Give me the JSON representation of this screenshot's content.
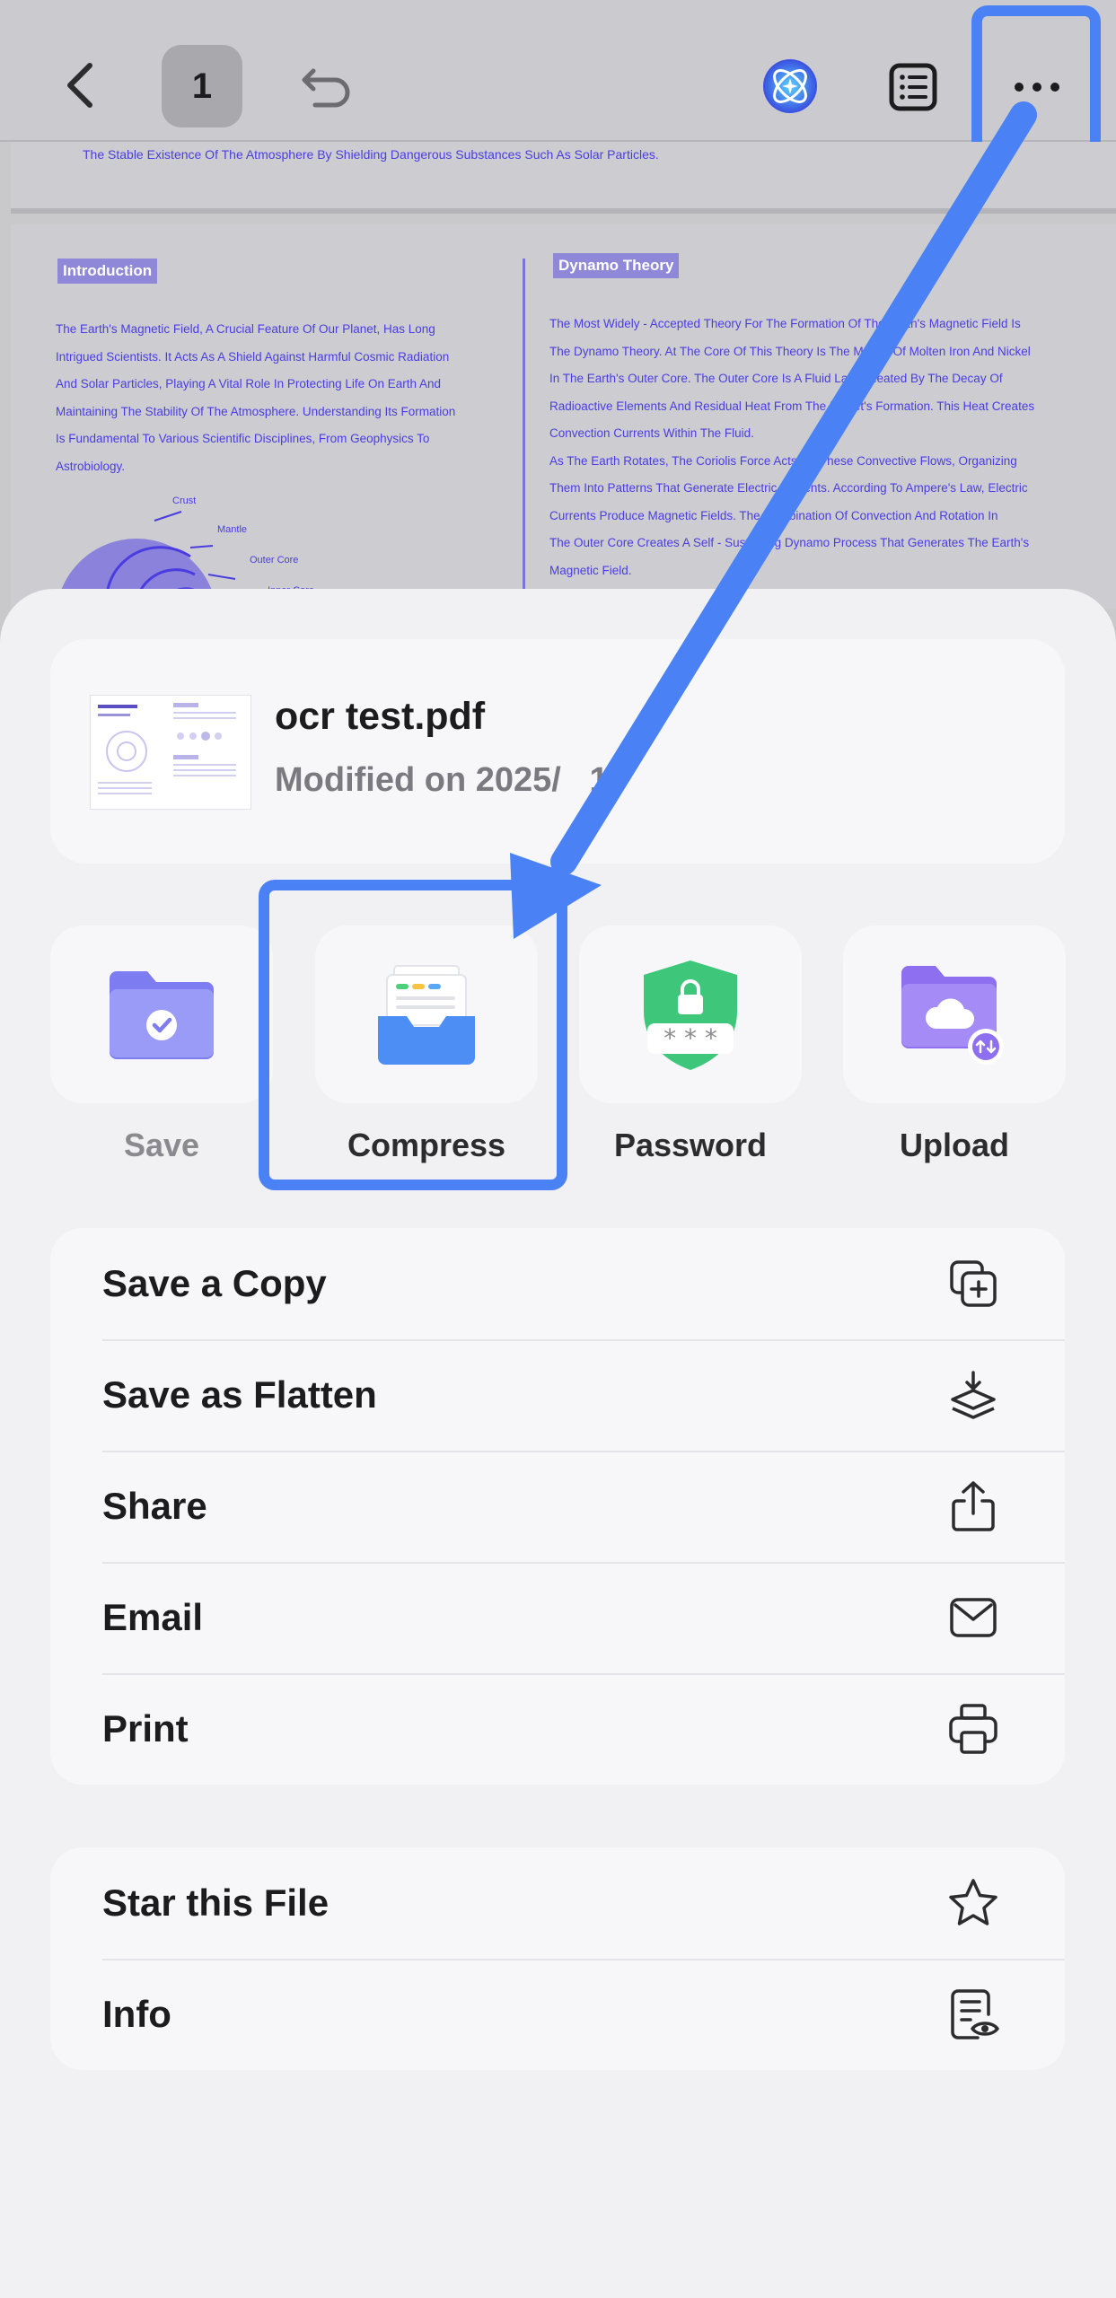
{
  "toolbar": {
    "page_number": "1",
    "icons": [
      "back-icon",
      "undo-icon",
      "ai-assistant-icon",
      "outline-icon",
      "more-icon"
    ]
  },
  "document": {
    "top_line": "The Stable Existence Of The Atmosphere By Shielding Dangerous Substances Such As Solar Particles.",
    "intro_heading": "Introduction",
    "intro_text": "The Earth's Magnetic Field, A Crucial Feature Of Our Planet, Has Long\nIntrigued Scientists. It Acts As A Shield Against Harmful Cosmic Radiation\nAnd Solar Particles, Playing A Vital Role In Protecting Life On Earth And\nMaintaining The Stability Of The Atmosphere. Understanding Its Formation\nIs Fundamental To Various Scientific Disciplines, From Geophysics To\nAstrobiology.",
    "diagram_labels": [
      "Crust",
      "Mantle",
      "Outer Core",
      "Inner Core"
    ],
    "dynamo_heading": "Dynamo Theory",
    "dynamo_text": "The Most Widely - Accepted Theory For The Formation Of The Earth's Magnetic Field Is\nThe Dynamo Theory. At The Core Of This Theory Is The Motion Of Molten Iron And Nickel\nIn The Earth's Outer Core. The Outer Core Is A Fluid Layer Heated By The Decay Of\nRadioactive Elements And Residual Heat From The Planet's Formation. This Heat Creates\nConvection Currents Within The Fluid.\nAs The Earth Rotates, The Coriolis Force Acts On These Convective Flows, Organizing\nThem Into Patterns That Generate Electric Currents. According To Ampere's Law, Electric\nCurrents Produce Magnetic Fields. The Combination Of Convection And Rotation In\nThe Outer Core Creates A Self - Sustaining Dynamo Process That Generates The Earth's\nMagnetic Field."
  },
  "file": {
    "name": "ocr test.pdf",
    "modified": "Modified on 2025/   10"
  },
  "actions": [
    {
      "label": "Save",
      "icon": "save-folder-icon",
      "enabled": false
    },
    {
      "label": "Compress",
      "icon": "compress-icon",
      "enabled": true
    },
    {
      "label": "Password",
      "icon": "password-shield-icon",
      "enabled": true
    },
    {
      "label": "Upload",
      "icon": "cloud-upload-folder-icon",
      "enabled": true
    }
  ],
  "menu_group_1": [
    {
      "label": "Save a Copy",
      "icon": "copy-plus-icon"
    },
    {
      "label": "Save as Flatten",
      "icon": "flatten-layers-icon"
    },
    {
      "label": "Share",
      "icon": "share-icon"
    },
    {
      "label": "Email",
      "icon": "mail-icon"
    },
    {
      "label": "Print",
      "icon": "printer-icon"
    }
  ],
  "menu_group_2": [
    {
      "label": "Star this File",
      "icon": "star-icon"
    },
    {
      "label": "Info",
      "icon": "info-document-icon"
    }
  ],
  "colors": {
    "highlight": "#4a82f5",
    "doc_text": "#4a3de0"
  }
}
